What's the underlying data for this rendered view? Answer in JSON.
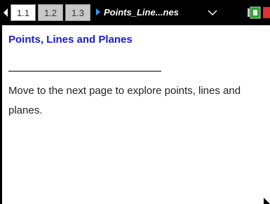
{
  "tabbar": {
    "tabs": [
      {
        "label": "1.1",
        "active": true
      },
      {
        "label": "1.2",
        "active": false
      },
      {
        "label": "1.3",
        "active": false
      }
    ],
    "doc_title": "Points_Line...nes",
    "icons": {
      "prev": "left-arrow-icon",
      "next": "right-arrow-icon",
      "dropdown": "chevron-down-icon",
      "battery": "battery-icon"
    }
  },
  "page": {
    "heading": "Points, Lines and Planes",
    "body": "Move to the next page to explore points, lines and planes."
  },
  "colors": {
    "heading": "#1a1ad9",
    "tabbar_bg": "#000000",
    "next_arrow": "#3399ff"
  }
}
